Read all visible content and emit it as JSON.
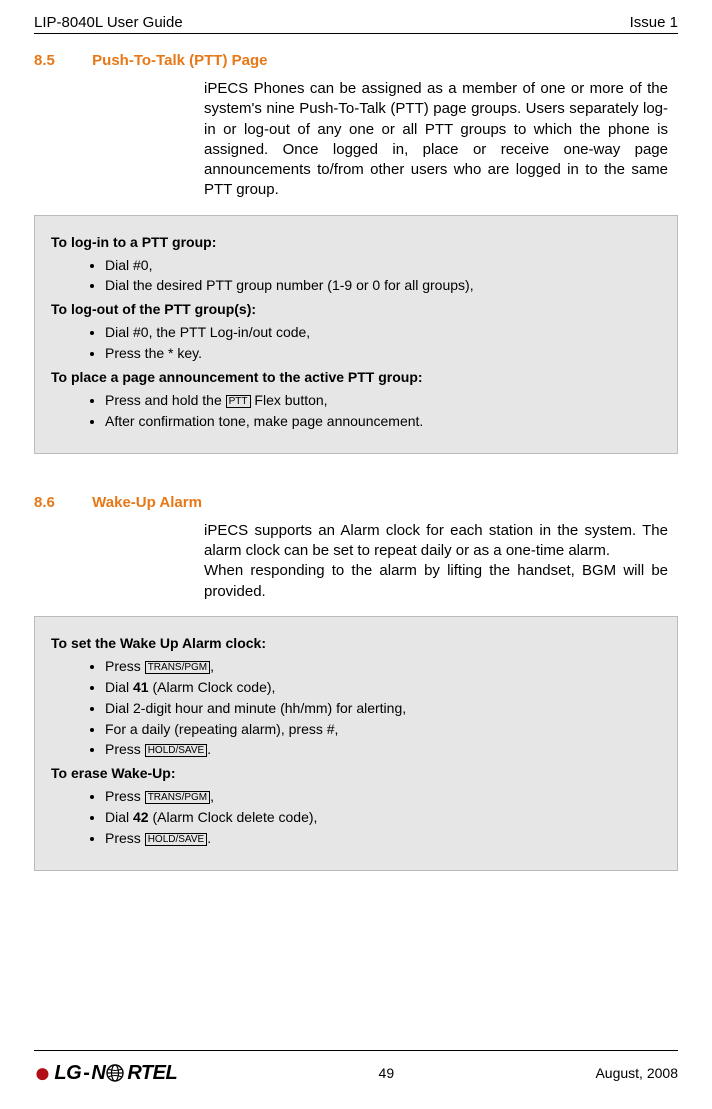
{
  "header": {
    "left": "LIP-8040L User Guide",
    "right": "Issue 1"
  },
  "section85": {
    "number": "8.5",
    "title": "Push-To-Talk (PTT) Page",
    "body": "iPECS Phones can be assigned as a member of one or more of the system's nine Push-To-Talk (PTT) page groups.  Users separately log-in or log-out of any one or all PTT groups to which the phone is assigned.  Once logged in, place or receive one-way page announcements to/from other users who are logged in to the same PTT group.",
    "box": {
      "h1": "To log-in to a PTT group:",
      "h1_items": [
        "Dial #0,",
        "Dial the desired PTT group number (1-9 or 0 for all groups),"
      ],
      "h2": "To log-out of the PTT group(s):",
      "h2_items": [
        "Dial #0, the PTT Log-in/out code,",
        "Press the * key."
      ],
      "h3": "To place a page announcement to the active PTT group:",
      "h3_item1_pre": "Press and hold the ",
      "h3_item1_key": "PTT",
      "h3_item1_post": " Flex button,",
      "h3_item2": "After confirmation tone, make page announcement."
    }
  },
  "section86": {
    "number": "8.6",
    "title": "Wake-Up Alarm",
    "body1": "iPECS supports an Alarm clock for each station in the system.  The alarm clock can be set to repeat daily or as a one-time alarm.",
    "body2": "When responding to the alarm by lifting the handset, BGM will be provided.",
    "box": {
      "h1": "To set the Wake Up Alarm clock:",
      "h1_item1_pre": "Press ",
      "h1_item1_key": "TRANS/PGM",
      "h1_item1_post": ",",
      "h1_item2_pre": "Dial ",
      "h1_item2_bold": "41",
      "h1_item2_post": " (Alarm Clock code),",
      "h1_item3": "Dial 2-digit hour and minute (hh/mm) for alerting,",
      "h1_item4": "For a daily (repeating alarm), press #,",
      "h1_item5_pre": "Press ",
      "h1_item5_key": "HOLD/SAVE",
      "h1_item5_post": ".",
      "h2": "To erase Wake-Up:",
      "h2_item1_pre": "Press ",
      "h2_item1_key": "TRANS/PGM",
      "h2_item1_post": ",",
      "h2_item2_pre": "Dial ",
      "h2_item2_bold": "42",
      "h2_item2_post": " (Alarm Clock delete code),",
      "h2_item3_pre": "Press ",
      "h2_item3_key": "HOLD/SAVE",
      "h2_item3_post": "."
    }
  },
  "footer": {
    "logo_left": "LG",
    "logo_right": "RTEL",
    "page": "49",
    "date": "August, 2008"
  }
}
